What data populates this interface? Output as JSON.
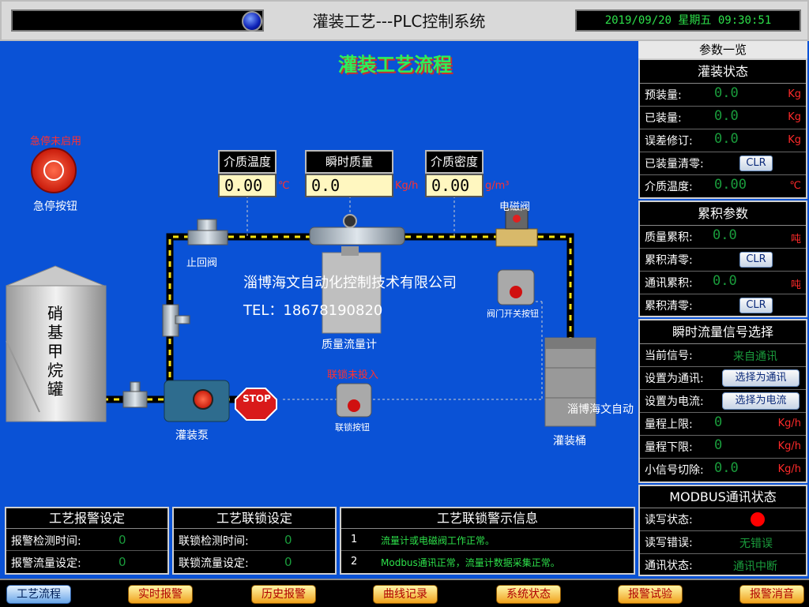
{
  "header": {
    "title": "灌装工艺---PLC控制系统",
    "datetime": "2019/09/20  星期五  09:30:51"
  },
  "process": {
    "title": "灌装工艺流程",
    "estop_status": "急停未启用",
    "estop_label": "急停按钮",
    "params": [
      {
        "name": "介质温度",
        "value": "0.00",
        "unit": "℃"
      },
      {
        "name": "瞬时质量",
        "value": "0.0",
        "unit": "Kg/h"
      },
      {
        "name": "介质密度",
        "value": "0.00",
        "unit": "g/m³"
      }
    ],
    "labels": {
      "check_valve": "止回阀",
      "solenoid_valve": "电磁阀",
      "valve_switch": "阀门开关按钮",
      "flowmeter": "质量流量计",
      "interlock_status": "联锁未投入",
      "interlock_button": "联锁按钮",
      "pump": "灌装泵",
      "stop": "STOP",
      "bucket": "灌装桶",
      "tank": "硝基甲烷罐"
    },
    "watermark_company": "淄博海文自动化控制技术有限公司",
    "watermark_tel": "TEL：18678190820",
    "watermark_small": "淄博海文自动"
  },
  "right_panel": {
    "title": "参数一览",
    "filling_state": {
      "title": "灌装状态",
      "rows": [
        {
          "key": "预装量:",
          "value": "0.0",
          "unit": "Kg"
        },
        {
          "key": "已装量:",
          "value": "0.0",
          "unit": "Kg"
        },
        {
          "key": "误差修订:",
          "value": "0.0",
          "unit": "Kg"
        },
        {
          "key": "已装量清零:",
          "button": "CLR"
        },
        {
          "key": "介质温度:",
          "value": "0.00",
          "unit": "℃"
        }
      ]
    },
    "accum": {
      "title": "累积参数",
      "rows": [
        {
          "key": "质量累积:",
          "value": "0.0",
          "unit": "吨"
        },
        {
          "key": "累积清零:",
          "button": "CLR"
        },
        {
          "key": "通讯累积:",
          "value": "0.0",
          "unit": "吨"
        },
        {
          "key": "累积清零:",
          "button": "CLR"
        }
      ]
    },
    "signal": {
      "title": "瞬时流量信号选择",
      "rows": [
        {
          "key": "当前信号:",
          "value": "来自通讯"
        },
        {
          "key": "设置为通讯:",
          "button": "选择为通讯"
        },
        {
          "key": "设置为电流:",
          "button": "选择为电流"
        },
        {
          "key": "量程上限:",
          "value": "0",
          "unit": "Kg/h"
        },
        {
          "key": "量程下限:",
          "value": "0",
          "unit": "Kg/h"
        },
        {
          "key": "小信号切除:",
          "value": "0.0",
          "unit": "Kg/h"
        }
      ]
    },
    "modbus": {
      "title": "MODBUS通讯状态",
      "rows": [
        {
          "key": "读写状态:",
          "indicator_color": "#ff0000"
        },
        {
          "key": "读写错误:",
          "value": "无错误"
        },
        {
          "key": "通讯状态:",
          "value": "通讯中断"
        }
      ]
    }
  },
  "bottom": {
    "alarm": {
      "title": "工艺报警设定",
      "rows": [
        {
          "key": "报警检测时间:",
          "value": "0"
        },
        {
          "key": "报警流量设定:",
          "value": "0"
        }
      ]
    },
    "interlock": {
      "title": "工艺联锁设定",
      "rows": [
        {
          "key": "联锁检测时间:",
          "value": "0"
        },
        {
          "key": "联锁流量设定:",
          "value": "0"
        }
      ]
    },
    "messages": {
      "title": "工艺联锁警示信息",
      "rows": [
        {
          "n": "1",
          "text": "流量计或电磁阀工作正常。"
        },
        {
          "n": "2",
          "text": "Modbus通讯正常，流量计数据采集正常。"
        }
      ]
    }
  },
  "nav": [
    "工艺流程",
    "实时报警",
    "历史报警",
    "曲线记录",
    "系统状态",
    "报警试验",
    "报警消音"
  ],
  "colors": {
    "background": "#0a52d6",
    "value_green": "#1a9c3c",
    "alarm_red": "#ff2a2a",
    "pipe_yellow": "#f7e210"
  }
}
